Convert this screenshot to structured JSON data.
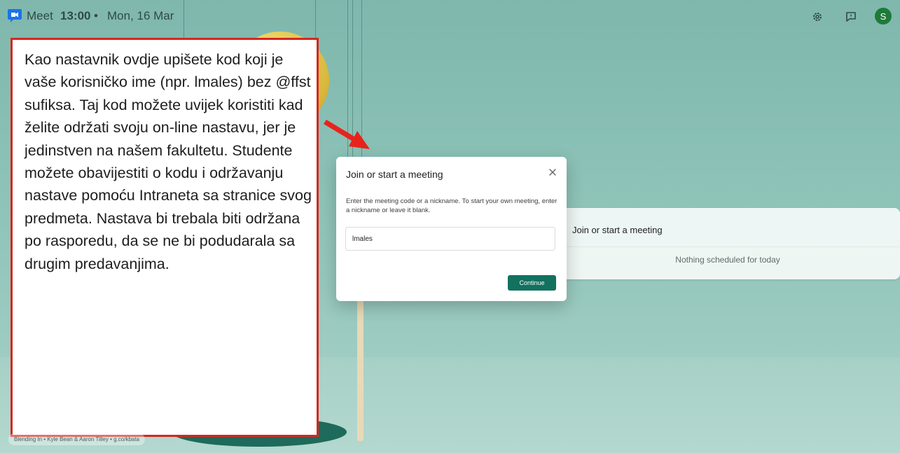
{
  "topbar": {
    "brand": "Meet",
    "time": "13:00",
    "separator": "•",
    "date": "Mon, 16 Mar",
    "avatar_letter": "S",
    "icons": [
      "meet-logo-icon",
      "gear-icon",
      "feedback-icon"
    ]
  },
  "annotation": {
    "text": "Kao nastavnik ovdje upišete kod koji je vaše korisničko ime (npr. lmales) bez @ffst sufiksa. Taj kod možete uvijek koristiti kad želite održati svoju on-line nastavu, jer je jedinstven na našem fakultetu. Studente možete obavijestiti o kodu i održavanju nastave pomoću Intraneta sa stranice svog predmeta. Nastava bi trebala biti održana po rasporedu, da se ne bi podudarala sa drugim predavanjima.",
    "border_color": "#d7261e",
    "arrow_color": "#e8231c"
  },
  "dialog": {
    "title": "Join or start a meeting",
    "description": "Enter the meeting code or a nickname. To start your own meeting, enter a nickname or leave it blank.",
    "input_value": "lmales",
    "continue_label": "Continue",
    "accent_color": "#12715f"
  },
  "schedule_panel": {
    "title": "Join or start a meeting",
    "empty_text": "Nothing scheduled for today"
  },
  "background": {
    "credit": "Blending In • Kyle Bean & Aaron Tilley • g.co/kbata"
  }
}
